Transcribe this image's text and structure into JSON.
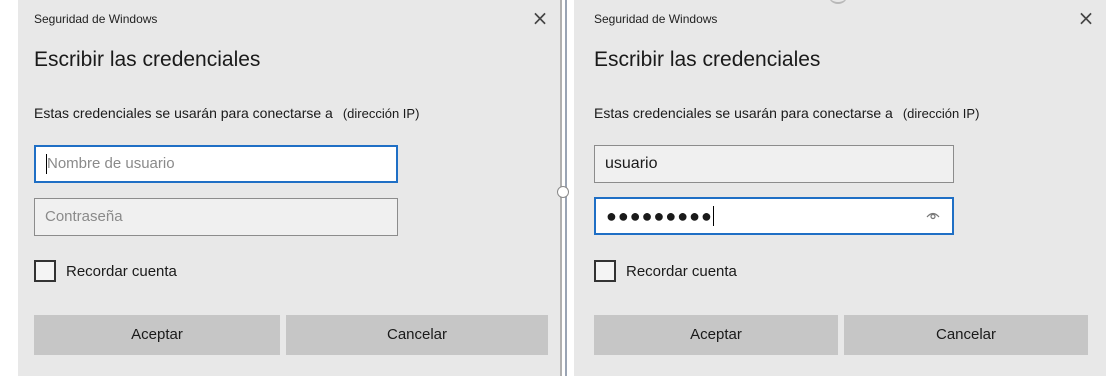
{
  "left_dialog": {
    "window_title": "Seguridad de Windows",
    "close_glyph": "×",
    "heading": "Escribir las credenciales",
    "description": "Estas credenciales se usarán para conectarse a",
    "ip_label": "(dirección IP)",
    "username": {
      "value": "",
      "placeholder": "Nombre de usuario",
      "focused": true
    },
    "password": {
      "value": "",
      "placeholder": "Contraseña"
    },
    "remember_label": "Recordar cuenta",
    "remember_checked": false,
    "ok_label": "Aceptar",
    "cancel_label": "Cancelar"
  },
  "right_dialog": {
    "window_title": "Seguridad de Windows",
    "close_glyph": "×",
    "heading": "Escribir las credenciales",
    "description": "Estas credenciales se usarán para conectarse a",
    "ip_label": "(dirección IP)",
    "username": {
      "value": "usuario",
      "placeholder": "Nombre de usuario"
    },
    "password": {
      "value": "●●●●●●●●●",
      "placeholder": "Contraseña",
      "focused": true,
      "reveal_icon": "eye-icon"
    },
    "remember_label": "Recordar cuenta",
    "remember_checked": false,
    "ok_label": "Aceptar",
    "cancel_label": "Cancelar"
  },
  "colors": {
    "dialog_bg": "#e8e8e8",
    "focus_border": "#1f6fc5",
    "button_bg": "#c6c6c6"
  }
}
